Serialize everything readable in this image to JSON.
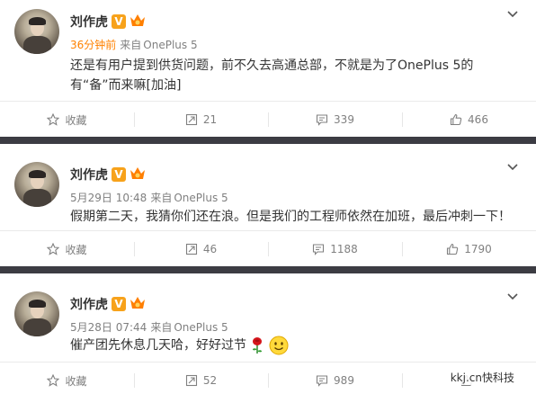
{
  "posts": [
    {
      "author": "刘作虎",
      "verified_mark": "V",
      "time": "36分钟前",
      "from": "来自",
      "source": "OnePlus 5",
      "text": "还是有用户提到供货问题，前不久去高通总部，不就是为了OnePlus 5的有“备”而来嘛[加油]",
      "actions": {
        "favorite": "收藏",
        "repost": "21",
        "comment": "339",
        "like": "466"
      }
    },
    {
      "author": "刘作虎",
      "verified_mark": "V",
      "time": "5月29日 10:48",
      "from": "来自",
      "source": "OnePlus 5",
      "text": "假期第二天，我猜你们还在浪。但是我们的工程师依然在加班，最后冲刺一下！",
      "actions": {
        "favorite": "收藏",
        "repost": "46",
        "comment": "1188",
        "like": "1790"
      }
    },
    {
      "author": "刘作虎",
      "verified_mark": "V",
      "time": "5月28日 07:44",
      "from": "来自",
      "source": "OnePlus 5",
      "text": "催产团先休息几天哈，好好过节",
      "emojis": [
        "rose-emoji",
        "smile-emoji"
      ],
      "actions": {
        "favorite": "收藏",
        "repost": "52",
        "comment": "989",
        "like": ""
      }
    }
  ],
  "watermark": "kkj.cn快科技",
  "colors": {
    "time_recent": "#ff8200",
    "meta_gray": "#808080",
    "separator": "#3c3c43",
    "verified_badge": "#f7a21b"
  }
}
